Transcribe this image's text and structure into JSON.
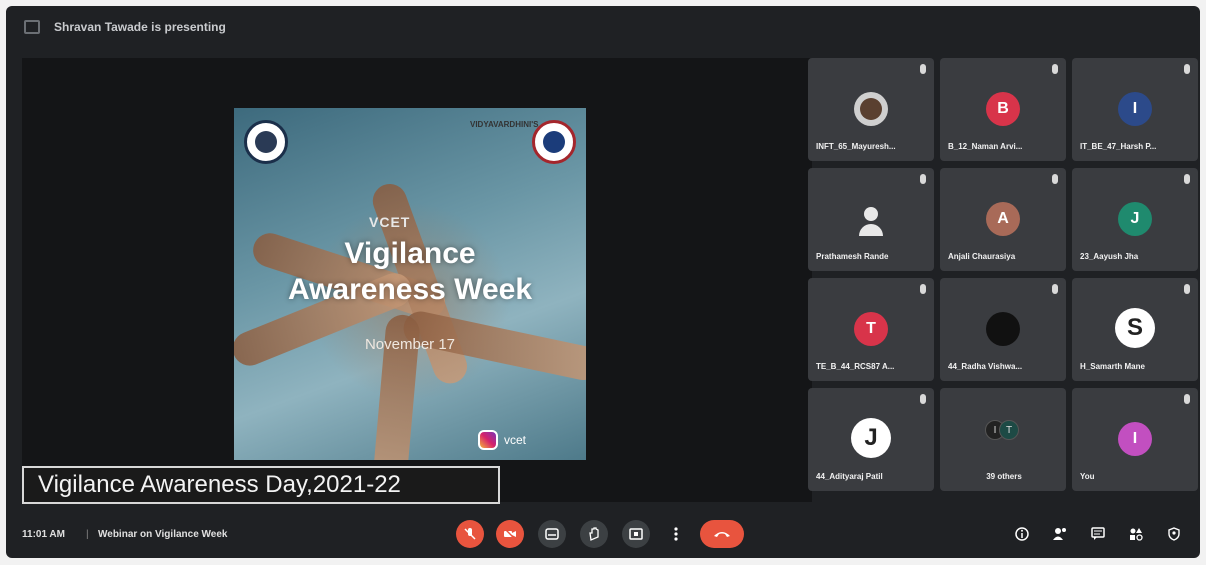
{
  "header": {
    "presenting_text": "Shravan Tawade is presenting"
  },
  "slide": {
    "top_text": "VIDYAVARDHINI'S",
    "tag": "VCET",
    "title_line1": "Vigilance",
    "title_line2": "Awareness Week",
    "date": "November 17",
    "handle": "vcet"
  },
  "caption": "Vigilance Awareness Day,2021-22",
  "participants": [
    {
      "name": "INFT_65_Mayuresh...",
      "avatar": "",
      "color": "#cfcfcf"
    },
    {
      "name": "B_12_Naman Arvi...",
      "avatar": "B",
      "color": "#d8344a"
    },
    {
      "name": "IT_BE_47_Harsh P...",
      "avatar": "I",
      "color": "#2c4a8a"
    },
    {
      "name": "Prathamesh Rande",
      "avatar": "",
      "color": "#e0e0e0"
    },
    {
      "name": "Anjali Chaurasiya",
      "avatar": "A",
      "color": "#a86a58"
    },
    {
      "name": "23_Aayush Jha",
      "avatar": "J",
      "color": "#1f8a6e"
    },
    {
      "name": "TE_B_44_RCS87 A...",
      "avatar": "T",
      "color": "#d8344a"
    },
    {
      "name": "44_Radha Vishwa...",
      "avatar": "",
      "color": "#111111"
    },
    {
      "name": "H_Samarth Mane",
      "avatar": "S",
      "color": "#ffffff"
    },
    {
      "name": "44_Adityaraj Patil",
      "avatar": "J",
      "color": "#ffffff"
    },
    {
      "name": "39 others",
      "avatar": "",
      "color": "#222222"
    },
    {
      "name": "You",
      "avatar": "I",
      "color": "#c24fc0"
    }
  ],
  "footer": {
    "time": "11:01 AM",
    "separator": "|",
    "meeting_title": "Webinar on Vigilance Week"
  },
  "icons": {
    "mic_off": "mic-off-icon",
    "camera_off": "camera-off-icon",
    "captions": "captions-icon",
    "raise_hand": "raise-hand-icon",
    "present": "present-icon",
    "more": "more-icon",
    "hangup": "hangup-icon",
    "info": "info-icon",
    "people": "people-icon",
    "chat": "chat-icon",
    "activities": "activities-icon",
    "host_controls": "host-controls-icon"
  },
  "colors": {
    "accent_red": "#e8543e",
    "surface": "#1f2124",
    "tile": "#3a3c40"
  }
}
